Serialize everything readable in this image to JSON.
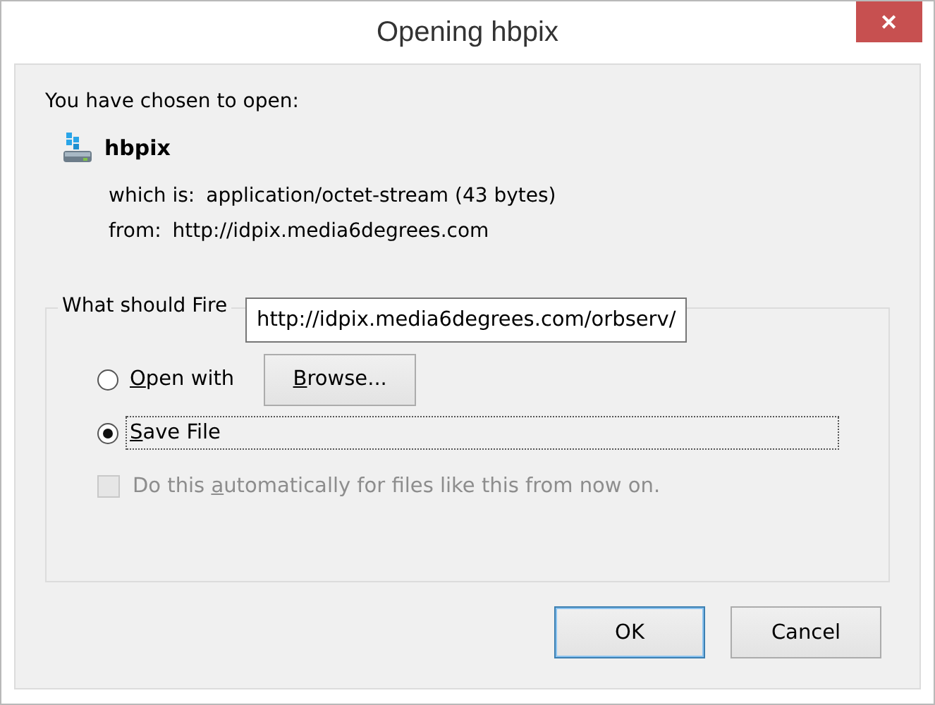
{
  "window": {
    "title": "Opening hbpix",
    "close": "✕"
  },
  "intro": "You have chosen to open:",
  "file": {
    "name": "hbpix",
    "type_label": "which is:",
    "type": "application/octet-stream (43 bytes)",
    "from_label": "from:",
    "from": "http://idpix.media6degrees.com"
  },
  "action_group": {
    "legend": "What should Fire",
    "options": [
      {
        "kind": "radio",
        "label": {
          "key": "O",
          "after": "pen with"
        },
        "selected": false,
        "focused": false,
        "button": {
          "key": "B",
          "after": "rowse..."
        }
      },
      {
        "kind": "radio",
        "label": {
          "key": "S",
          "after": "ave File"
        },
        "selected": true,
        "focused": true
      }
    ],
    "auto": {
      "label": {
        "before": "Do this ",
        "key": "a",
        "after": "utomatically for files like this from now on."
      },
      "checked": false,
      "disabled": true
    }
  },
  "tooltip": "http://idpix.media6degrees.com/orbserv/",
  "buttons": [
    {
      "label": "OK",
      "default": true
    },
    {
      "label": "Cancel",
      "default": false
    }
  ]
}
